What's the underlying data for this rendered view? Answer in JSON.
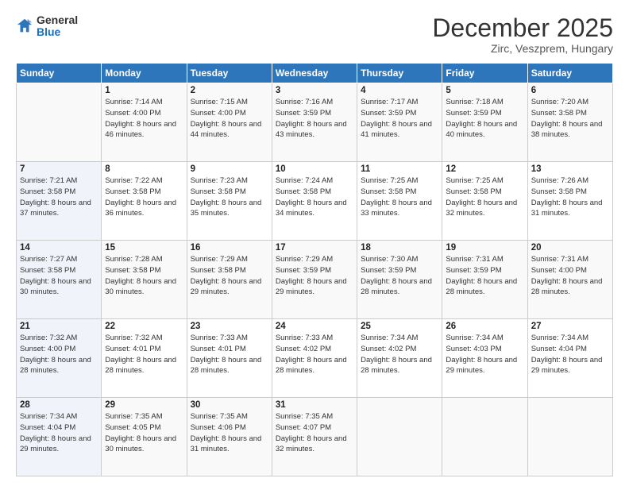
{
  "logo": {
    "general": "General",
    "blue": "Blue"
  },
  "header": {
    "month_year": "December 2025",
    "location": "Zirc, Veszprem, Hungary"
  },
  "weekdays": [
    "Sunday",
    "Monday",
    "Tuesday",
    "Wednesday",
    "Thursday",
    "Friday",
    "Saturday"
  ],
  "weeks": [
    [
      {
        "day": "",
        "sunrise": "",
        "sunset": "",
        "daylight": ""
      },
      {
        "day": "1",
        "sunrise": "Sunrise: 7:14 AM",
        "sunset": "Sunset: 4:00 PM",
        "daylight": "Daylight: 8 hours and 46 minutes."
      },
      {
        "day": "2",
        "sunrise": "Sunrise: 7:15 AM",
        "sunset": "Sunset: 4:00 PM",
        "daylight": "Daylight: 8 hours and 44 minutes."
      },
      {
        "day": "3",
        "sunrise": "Sunrise: 7:16 AM",
        "sunset": "Sunset: 3:59 PM",
        "daylight": "Daylight: 8 hours and 43 minutes."
      },
      {
        "day": "4",
        "sunrise": "Sunrise: 7:17 AM",
        "sunset": "Sunset: 3:59 PM",
        "daylight": "Daylight: 8 hours and 41 minutes."
      },
      {
        "day": "5",
        "sunrise": "Sunrise: 7:18 AM",
        "sunset": "Sunset: 3:59 PM",
        "daylight": "Daylight: 8 hours and 40 minutes."
      },
      {
        "day": "6",
        "sunrise": "Sunrise: 7:20 AM",
        "sunset": "Sunset: 3:58 PM",
        "daylight": "Daylight: 8 hours and 38 minutes."
      }
    ],
    [
      {
        "day": "7",
        "sunrise": "Sunrise: 7:21 AM",
        "sunset": "Sunset: 3:58 PM",
        "daylight": "Daylight: 8 hours and 37 minutes."
      },
      {
        "day": "8",
        "sunrise": "Sunrise: 7:22 AM",
        "sunset": "Sunset: 3:58 PM",
        "daylight": "Daylight: 8 hours and 36 minutes."
      },
      {
        "day": "9",
        "sunrise": "Sunrise: 7:23 AM",
        "sunset": "Sunset: 3:58 PM",
        "daylight": "Daylight: 8 hours and 35 minutes."
      },
      {
        "day": "10",
        "sunrise": "Sunrise: 7:24 AM",
        "sunset": "Sunset: 3:58 PM",
        "daylight": "Daylight: 8 hours and 34 minutes."
      },
      {
        "day": "11",
        "sunrise": "Sunrise: 7:25 AM",
        "sunset": "Sunset: 3:58 PM",
        "daylight": "Daylight: 8 hours and 33 minutes."
      },
      {
        "day": "12",
        "sunrise": "Sunrise: 7:25 AM",
        "sunset": "Sunset: 3:58 PM",
        "daylight": "Daylight: 8 hours and 32 minutes."
      },
      {
        "day": "13",
        "sunrise": "Sunrise: 7:26 AM",
        "sunset": "Sunset: 3:58 PM",
        "daylight": "Daylight: 8 hours and 31 minutes."
      }
    ],
    [
      {
        "day": "14",
        "sunrise": "Sunrise: 7:27 AM",
        "sunset": "Sunset: 3:58 PM",
        "daylight": "Daylight: 8 hours and 30 minutes."
      },
      {
        "day": "15",
        "sunrise": "Sunrise: 7:28 AM",
        "sunset": "Sunset: 3:58 PM",
        "daylight": "Daylight: 8 hours and 30 minutes."
      },
      {
        "day": "16",
        "sunrise": "Sunrise: 7:29 AM",
        "sunset": "Sunset: 3:58 PM",
        "daylight": "Daylight: 8 hours and 29 minutes."
      },
      {
        "day": "17",
        "sunrise": "Sunrise: 7:29 AM",
        "sunset": "Sunset: 3:59 PM",
        "daylight": "Daylight: 8 hours and 29 minutes."
      },
      {
        "day": "18",
        "sunrise": "Sunrise: 7:30 AM",
        "sunset": "Sunset: 3:59 PM",
        "daylight": "Daylight: 8 hours and 28 minutes."
      },
      {
        "day": "19",
        "sunrise": "Sunrise: 7:31 AM",
        "sunset": "Sunset: 3:59 PM",
        "daylight": "Daylight: 8 hours and 28 minutes."
      },
      {
        "day": "20",
        "sunrise": "Sunrise: 7:31 AM",
        "sunset": "Sunset: 4:00 PM",
        "daylight": "Daylight: 8 hours and 28 minutes."
      }
    ],
    [
      {
        "day": "21",
        "sunrise": "Sunrise: 7:32 AM",
        "sunset": "Sunset: 4:00 PM",
        "daylight": "Daylight: 8 hours and 28 minutes."
      },
      {
        "day": "22",
        "sunrise": "Sunrise: 7:32 AM",
        "sunset": "Sunset: 4:01 PM",
        "daylight": "Daylight: 8 hours and 28 minutes."
      },
      {
        "day": "23",
        "sunrise": "Sunrise: 7:33 AM",
        "sunset": "Sunset: 4:01 PM",
        "daylight": "Daylight: 8 hours and 28 minutes."
      },
      {
        "day": "24",
        "sunrise": "Sunrise: 7:33 AM",
        "sunset": "Sunset: 4:02 PM",
        "daylight": "Daylight: 8 hours and 28 minutes."
      },
      {
        "day": "25",
        "sunrise": "Sunrise: 7:34 AM",
        "sunset": "Sunset: 4:02 PM",
        "daylight": "Daylight: 8 hours and 28 minutes."
      },
      {
        "day": "26",
        "sunrise": "Sunrise: 7:34 AM",
        "sunset": "Sunset: 4:03 PM",
        "daylight": "Daylight: 8 hours and 29 minutes."
      },
      {
        "day": "27",
        "sunrise": "Sunrise: 7:34 AM",
        "sunset": "Sunset: 4:04 PM",
        "daylight": "Daylight: 8 hours and 29 minutes."
      }
    ],
    [
      {
        "day": "28",
        "sunrise": "Sunrise: 7:34 AM",
        "sunset": "Sunset: 4:04 PM",
        "daylight": "Daylight: 8 hours and 29 minutes."
      },
      {
        "day": "29",
        "sunrise": "Sunrise: 7:35 AM",
        "sunset": "Sunset: 4:05 PM",
        "daylight": "Daylight: 8 hours and 30 minutes."
      },
      {
        "day": "30",
        "sunrise": "Sunrise: 7:35 AM",
        "sunset": "Sunset: 4:06 PM",
        "daylight": "Daylight: 8 hours and 31 minutes."
      },
      {
        "day": "31",
        "sunrise": "Sunrise: 7:35 AM",
        "sunset": "Sunset: 4:07 PM",
        "daylight": "Daylight: 8 hours and 32 minutes."
      },
      {
        "day": "",
        "sunrise": "",
        "sunset": "",
        "daylight": ""
      },
      {
        "day": "",
        "sunrise": "",
        "sunset": "",
        "daylight": ""
      },
      {
        "day": "",
        "sunrise": "",
        "sunset": "",
        "daylight": ""
      }
    ]
  ]
}
